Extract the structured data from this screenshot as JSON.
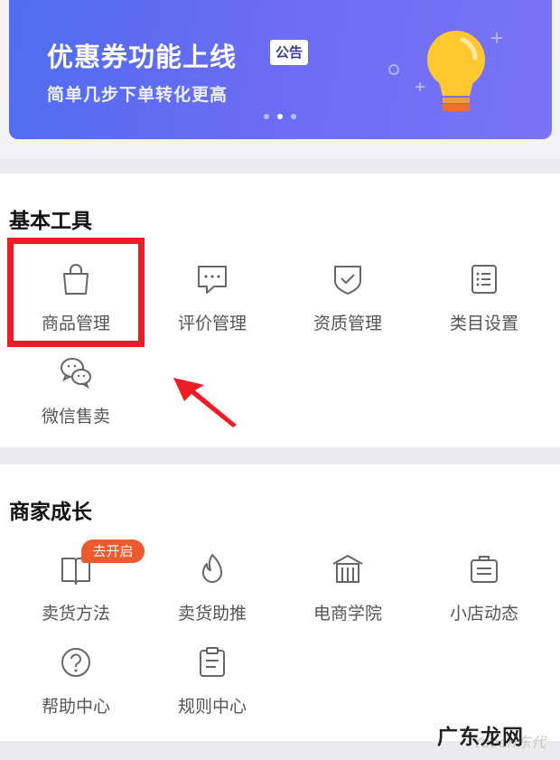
{
  "banner": {
    "title": "优惠券功能上线",
    "badge": "公告",
    "subtitle": "简单几步下单转化更高",
    "pager": {
      "count": 3,
      "active_index": 1
    },
    "colors": {
      "gradient_start": "#4f6df0",
      "gradient_end": "#7b73f6",
      "bulb": "#ffc830",
      "bulb_base": "#ef6c3c"
    }
  },
  "basic_tools": {
    "title": "基本工具",
    "items": [
      {
        "label": "商品管理",
        "icon": "shopping-bag-icon",
        "highlighted": true
      },
      {
        "label": "评价管理",
        "icon": "comment-icon"
      },
      {
        "label": "资质管理",
        "icon": "shield-check-icon"
      },
      {
        "label": "类目设置",
        "icon": "list-icon"
      },
      {
        "label": "微信售卖",
        "icon": "wechat-icon"
      }
    ]
  },
  "merchant_growth": {
    "title": "商家成长",
    "items": [
      {
        "label": "卖货方法",
        "icon": "book-icon",
        "badge": "去开启"
      },
      {
        "label": "卖货助推",
        "icon": "flame-icon"
      },
      {
        "label": "电商学院",
        "icon": "school-icon"
      },
      {
        "label": "小店动态",
        "icon": "briefcase-icon"
      },
      {
        "label": "帮助中心",
        "icon": "help-icon"
      },
      {
        "label": "规则中心",
        "icon": "clipboard-icon"
      }
    ]
  },
  "annotation": {
    "highlight_color": "#ee1c25",
    "arrow_color": "#ee1c25"
  },
  "watermark": {
    "text": "广东龙网",
    "sub": "Yaoon东代"
  }
}
